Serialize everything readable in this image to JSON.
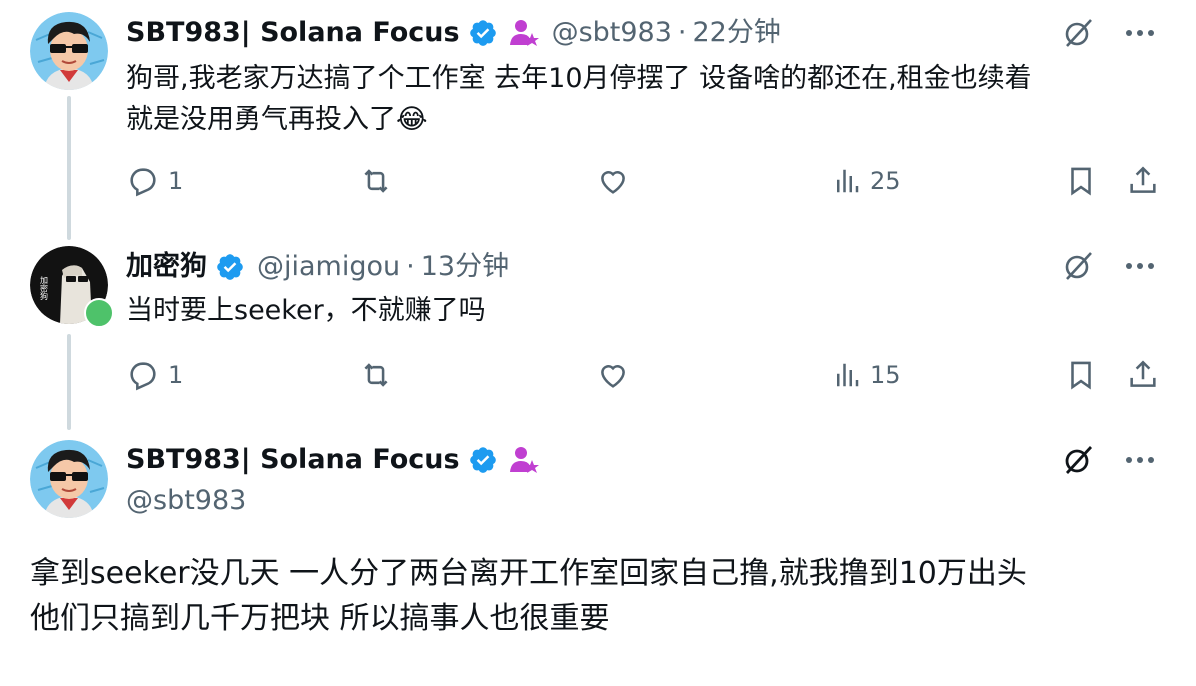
{
  "tweets": [
    {
      "display_name": "SBT983| Solana Focus",
      "handle": "@sbt983",
      "separator": "·",
      "time": "22分钟",
      "text_lines": [
        "狗哥,我老家万达搞了个工作室  去年10月停摆了  设备啥的都还在,租金也续着",
        "就是没用勇气再投入了😂"
      ],
      "replies": "1",
      "views": "25"
    },
    {
      "display_name": "加密狗",
      "handle": "@jiamigou",
      "separator": "·",
      "time": "13分钟",
      "text_lines": [
        "当时要上seeker，不就赚了吗"
      ],
      "replies": "1",
      "views": "15",
      "avatar_text": "加密狗"
    },
    {
      "display_name": "SBT983| Solana Focus",
      "handle": "@sbt983",
      "text_lines": [
        "拿到seeker没几天  一人分了两台离开工作室回家自己撸,就我撸到10万出头",
        "他们只搞到几千万把块   所以搞事人也很重要"
      ]
    }
  ],
  "icons": {
    "verified": "verified-badge-icon",
    "affiliate": "affiliate-icon",
    "grok": "grok-icon",
    "more": "more-icon",
    "reply": "reply-icon",
    "retweet": "retweet-icon",
    "like": "like-icon",
    "views": "views-icon",
    "bookmark": "bookmark-icon",
    "share": "share-icon"
  },
  "colors": {
    "verified": "#1d9bf0",
    "affiliate": "#c03fd1",
    "muted": "#536471",
    "thread_line": "#cfd9de"
  }
}
